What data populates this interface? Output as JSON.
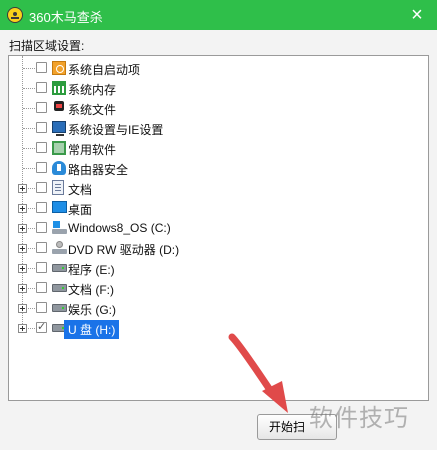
{
  "window": {
    "title": "360木马查杀",
    "close_glyph": "×"
  },
  "scan_area_label": "扫描区域设置:",
  "tree": [
    {
      "label": "系统自启动项",
      "icon": "startup-icon",
      "checked": false,
      "expandable": false
    },
    {
      "label": "系统内存",
      "icon": "memory-icon",
      "checked": false,
      "expandable": false
    },
    {
      "label": "系统文件",
      "icon": "system-files-icon",
      "checked": false,
      "expandable": false
    },
    {
      "label": "系统设置与IE设置",
      "icon": "monitor-settings-icon",
      "checked": false,
      "expandable": false
    },
    {
      "label": "常用软件",
      "icon": "software-icon",
      "checked": false,
      "expandable": false
    },
    {
      "label": "路由器安全",
      "icon": "router-shield-icon",
      "checked": false,
      "expandable": false
    },
    {
      "label": "文档",
      "icon": "document-icon",
      "checked": false,
      "expandable": true
    },
    {
      "label": "桌面",
      "icon": "desktop-icon",
      "checked": false,
      "expandable": true
    },
    {
      "label": "Windows8_OS (C:)",
      "icon": "windows-drive-icon",
      "checked": false,
      "expandable": true
    },
    {
      "label": "DVD RW 驱动器 (D:)",
      "icon": "dvd-drive-icon",
      "checked": false,
      "expandable": true
    },
    {
      "label": "程序 (E:)",
      "icon": "drive-icon",
      "checked": false,
      "expandable": true
    },
    {
      "label": "文档 (F:)",
      "icon": "drive-icon",
      "checked": false,
      "expandable": true
    },
    {
      "label": "娱乐 (G:)",
      "icon": "drive-icon",
      "checked": false,
      "expandable": true
    },
    {
      "label": "U 盘 (H:)",
      "icon": "usb-drive-icon",
      "checked": true,
      "expandable": true,
      "selected": true
    }
  ],
  "scan_button_label": "开始扫",
  "watermark": "软件技巧",
  "colors": {
    "titlebar": "#2fbf4a",
    "selection": "#1a73e8",
    "arrow": "#e04a4a"
  }
}
